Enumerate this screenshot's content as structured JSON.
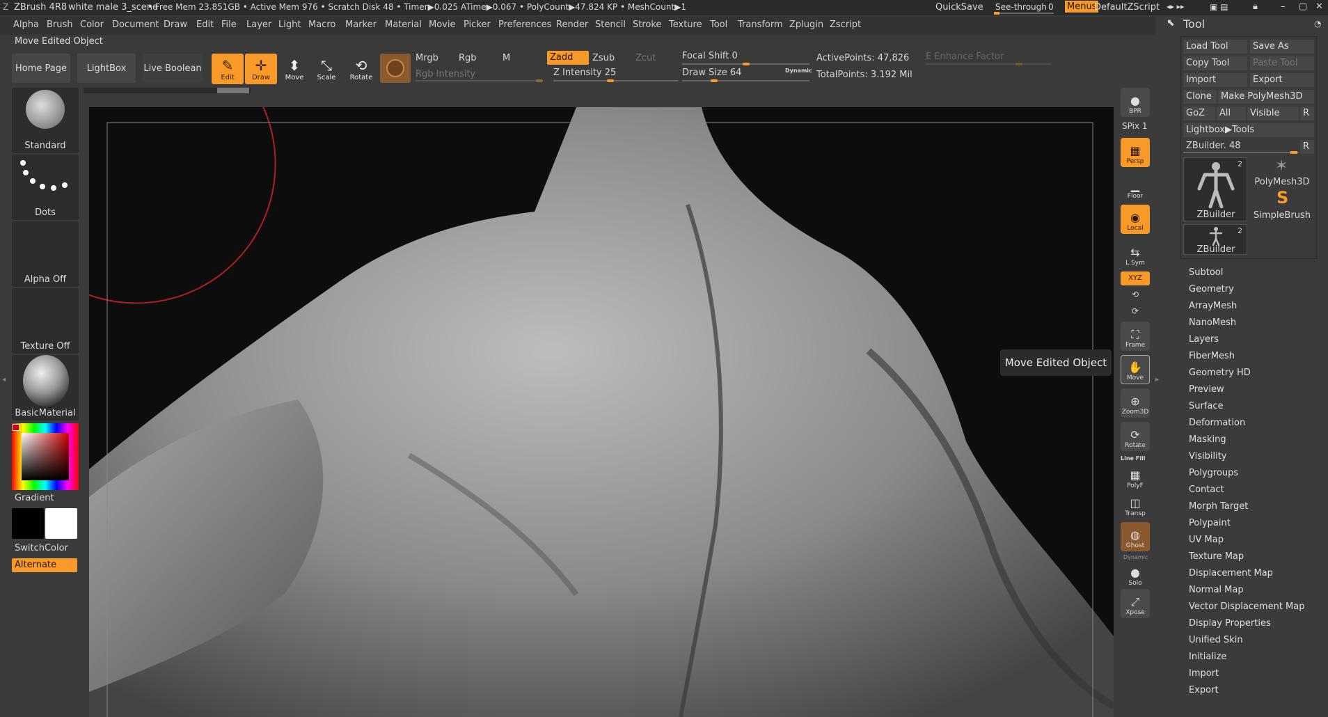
{
  "titlebar": {
    "app": "ZBrush 4R8",
    "file": "white male 3_scene",
    "stats": "• Free Mem 23.851GB • Active Mem 976 • Scratch Disk 48 •  Timer▶0.025 ATime▶0.067 • PolyCount▶47.824 KP  • MeshCount▶1",
    "quicksave": "QuickSave",
    "see_through_label": "See-through",
    "see_through_value": "0",
    "menus": "Menus",
    "zscript": "DefaultZScript"
  },
  "menu": [
    "Alpha",
    "Brush",
    "Color",
    "Document",
    "Draw",
    "Edit",
    "File",
    "Layer",
    "Light",
    "Macro",
    "Marker",
    "Material",
    "Movie",
    "Picker",
    "Preferences",
    "Render",
    "Stencil",
    "Stroke",
    "Texture",
    "Tool",
    "Transform",
    "Zplugin",
    "Zscript"
  ],
  "subtitle": "Move Edited Object",
  "shelf": {
    "tabs": [
      "Home Page",
      "LightBox",
      "Live Boolean"
    ],
    "tools": [
      {
        "label": "Edit",
        "icon": "✎",
        "on": true
      },
      {
        "label": "Draw",
        "icon": "✛",
        "on": true
      },
      {
        "label": "Move",
        "icon": "M",
        "on": false
      },
      {
        "label": "Scale",
        "icon": "S",
        "on": false
      },
      {
        "label": "Rotate",
        "icon": "R",
        "on": false
      }
    ],
    "mrgb": "Mrgb",
    "rgb": "Rgb",
    "m": "M",
    "rgb_intensity": "Rgb Intensity",
    "zadd": "Zadd",
    "zsub": "Zsub",
    "zcut": "Zcut",
    "z_intensity": "Z Intensity 25",
    "focal_shift": "Focal Shift 0",
    "draw_size": "Draw Size 64",
    "dynamic": "Dynamic",
    "active_points": "ActivePoints: 47,826",
    "total_points": "TotalPoints: 3.192 Mil",
    "enhance": "E Enhance Factor"
  },
  "left": {
    "brush": "Standard",
    "stroke": "Dots",
    "alpha": "Alpha Off",
    "texture": "Texture Off",
    "material": "BasicMaterial",
    "gradient": "Gradient",
    "switchcolor": "SwitchColor",
    "alternate": "Alternate",
    "colors": {
      "main": "#000000",
      "secondary": "#ffffff",
      "accent": "#f79a2a"
    }
  },
  "rightstrip": {
    "spix": "SPix 1",
    "buttons": [
      {
        "label": "BPR",
        "icon": "●",
        "on": false
      },
      {
        "label": "Persp",
        "icon": "▦",
        "on": true
      },
      {
        "label": "Floor",
        "icon": "▁",
        "on": false
      },
      {
        "label": "Local",
        "icon": "◉",
        "on": true
      },
      {
        "label": "L.Sym",
        "icon": "⇆",
        "on": false
      },
      {
        "label": "XYZ",
        "icon": "✶",
        "on": true
      },
      {
        "label": "Frame",
        "icon": "⛶",
        "on": false
      },
      {
        "label": "Move",
        "icon": "✋",
        "on": false
      },
      {
        "label": "Zoom3D",
        "icon": "⊕",
        "on": false
      },
      {
        "label": "Rotate",
        "icon": "⟳",
        "on": false
      },
      {
        "label": "PolyF",
        "icon": "▦",
        "on": false
      },
      {
        "label": "Transp",
        "icon": "◫",
        "on": false
      },
      {
        "label": "Ghost",
        "icon": "◍",
        "on": false
      },
      {
        "label": "Solo",
        "icon": "●",
        "on": false
      },
      {
        "label": "Xpose",
        "icon": "⤢",
        "on": false
      }
    ],
    "line_fill": "Line Fill",
    "dynamic": "Dynamic"
  },
  "tooltip": "Move Edited Object",
  "toolpalette": {
    "title": "Tool",
    "load": "Load Tool",
    "saveas": "Save As",
    "copy": "Copy Tool",
    "paste": "Paste Tool",
    "import": "Import",
    "export": "Export",
    "clone": "Clone",
    "make_poly": "Make PolyMesh3D",
    "goz": "GoZ",
    "all": "All",
    "visible": "Visible",
    "r": "R",
    "lightbox_tools": "Lightbox▶Tools",
    "zbuilder_slider": "ZBuilder. 48",
    "thumbs": [
      {
        "name": "ZBuilder",
        "count": "2"
      },
      {
        "name": "PolyMesh3D",
        "count": ""
      },
      {
        "name": "SimpleBrush",
        "count": ""
      },
      {
        "name": "ZBuilder",
        "count": "2"
      }
    ],
    "items": [
      "Subtool",
      "Geometry",
      "ArrayMesh",
      "NanoMesh",
      "Layers",
      "FiberMesh",
      "Geometry HD",
      "Preview",
      "Surface",
      "Deformation",
      "Masking",
      "Visibility",
      "Polygroups",
      "Contact",
      "Morph Target",
      "Polypaint",
      "UV Map",
      "Texture Map",
      "Displacement Map",
      "Normal Map",
      "Vector Displacement Map",
      "Display Properties",
      "Unified Skin",
      "Initialize",
      "Import",
      "Export"
    ]
  }
}
